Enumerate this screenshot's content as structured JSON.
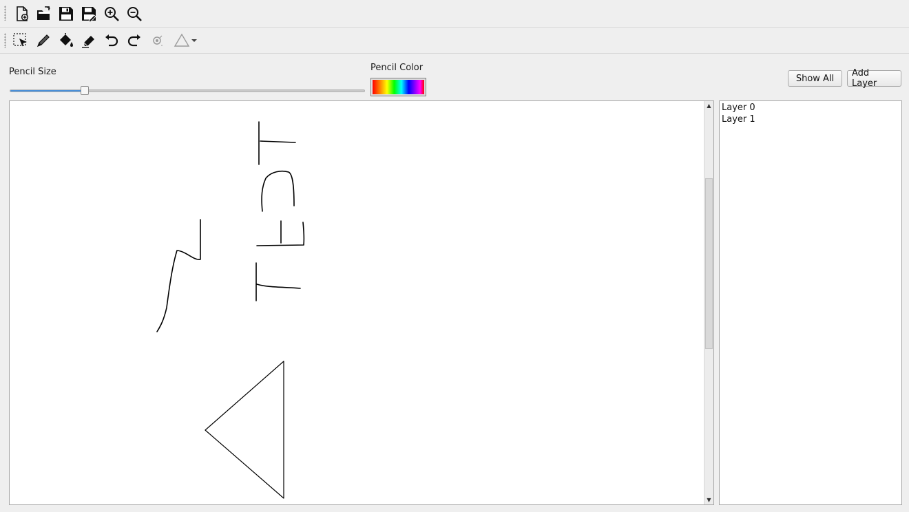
{
  "toolbar_file": {
    "buttons": [
      {
        "name": "new-file-icon"
      },
      {
        "name": "open-file-icon"
      },
      {
        "name": "save-icon"
      },
      {
        "name": "save-as-icon"
      },
      {
        "name": "zoom-in-icon"
      },
      {
        "name": "zoom-out-icon"
      }
    ]
  },
  "toolbar_tools": {
    "buttons": [
      {
        "name": "select-tool-icon"
      },
      {
        "name": "pencil-tool-icon"
      },
      {
        "name": "fill-bucket-icon"
      },
      {
        "name": "eraser-icon"
      },
      {
        "name": "undo-icon"
      },
      {
        "name": "redo-icon"
      },
      {
        "name": "spray-icon",
        "disabled": true
      },
      {
        "name": "triangle-shape-icon",
        "has_dropdown": true
      }
    ]
  },
  "controls": {
    "pencil_size_label": "Pencil Size",
    "pencil_size_value": 0.21,
    "pencil_color_label": "Pencil Color",
    "show_all_label": "Show All",
    "add_layer_label": "Add Layer"
  },
  "canvas": {
    "background": "#ffffff",
    "stroke_color": "#000000",
    "scroll_position": 0.19
  },
  "layers": {
    "items": [
      "Layer 0",
      "Layer 1"
    ]
  },
  "colors": {
    "slider_fill": "#4a90d9",
    "window_bg": "#efefef"
  }
}
